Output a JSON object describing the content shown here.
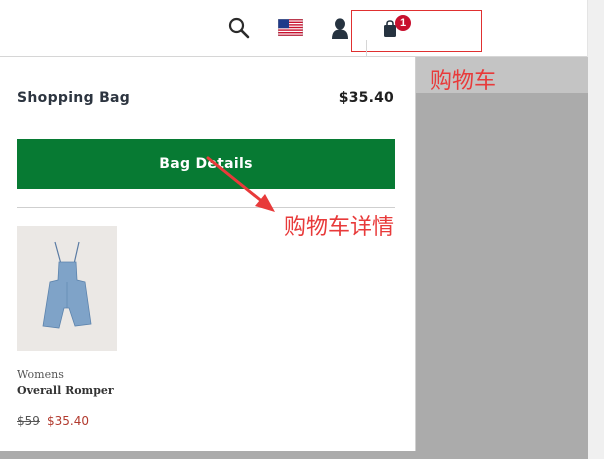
{
  "header": {
    "cart_count": "1",
    "icons": [
      "search-icon",
      "us-flag-icon",
      "account-icon",
      "shopping-bag-icon"
    ]
  },
  "panel": {
    "title": "Shopping Bag",
    "total": "$35.40",
    "details_button": "Bag Details"
  },
  "product": {
    "gender": "Womens",
    "name": "Overall Romper",
    "price_original": "$59",
    "price_sale": "$35.40"
  },
  "annotations": {
    "cart": "购物车",
    "details": "购物车详情"
  },
  "colors": {
    "button_green": "#077a33",
    "badge_red": "#c8102e",
    "annotation_red": "#e83a3a",
    "sale_red": "#b23a2e"
  }
}
